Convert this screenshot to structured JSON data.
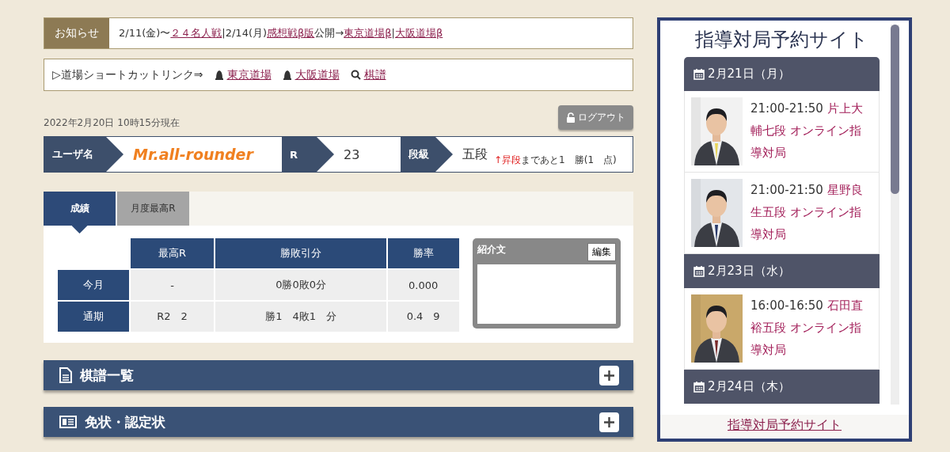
{
  "notice": {
    "label": "お知らせ",
    "segments": [
      {
        "kind": "text",
        "text": "2/11(金)〜"
      },
      {
        "kind": "link",
        "text": "２４名人戦"
      },
      {
        "kind": "text",
        "text": "|2/14(月)"
      },
      {
        "kind": "link",
        "text": "感想戦β版"
      },
      {
        "kind": "text",
        "text": "公開→"
      },
      {
        "kind": "link",
        "text": "東京道場β"
      },
      {
        "kind": "text",
        "text": "|"
      },
      {
        "kind": "link",
        "text": "大阪道場β"
      }
    ]
  },
  "shortcuts": {
    "label": "▷道場ショートカットリンク⇒",
    "links": [
      {
        "kind": "dojo",
        "text": "東京道場"
      },
      {
        "kind": "dojo",
        "text": "大阪道場"
      },
      {
        "kind": "search",
        "text": "棋譜"
      }
    ]
  },
  "timestamp": "2022年2月20日 10時15分現在",
  "logout_button": "ログアウト",
  "profile": {
    "fields": [
      {
        "kind": "name",
        "label": "ユーザ名",
        "value": "Mr.all-rounder"
      },
      {
        "kind": "plain",
        "label": "R",
        "value": "23"
      },
      {
        "kind": "rank",
        "label": "段級",
        "value": "五段"
      }
    ],
    "promotion": {
      "highlight": "↑昇段",
      "rest": "まであと1　勝(1　点)"
    }
  },
  "tabs": [
    {
      "label": "成績",
      "selected": true
    },
    {
      "label": "月度最高R",
      "selected": false
    }
  ],
  "stats": {
    "columns": [
      "最高R",
      "勝敗引分",
      "勝率"
    ],
    "rows": [
      {
        "label": "今月",
        "cells": [
          "-",
          "0勝0敗0分",
          "0.000"
        ]
      },
      {
        "label": "通期",
        "cells": [
          "R2　2",
          "勝1　4敗1　分",
          "0.4　9"
        ]
      }
    ]
  },
  "intro": {
    "title": "紹介文",
    "edit_button": "編集"
  },
  "sections": [
    {
      "kind": "document",
      "title": "棋譜一覧",
      "expanded": false
    },
    {
      "kind": "certificate",
      "title": "免状・認定状",
      "expanded": false
    }
  ],
  "booking": {
    "title": "指導対局予約サイト",
    "days": [
      {
        "date": "2月21日（月）",
        "lessons": [
          {
            "time": "21:00-21:50",
            "title": "片上大輔七段 オンライン指導対局"
          },
          {
            "time": "21:00-21:50",
            "title": "星野良生五段 オンライン指導対局"
          }
        ]
      },
      {
        "date": "2月23日（水）",
        "lessons": [
          {
            "time": "16:00-16:50",
            "title": "石田直裕五段 オンライン指導対局"
          }
        ]
      },
      {
        "date": "2月24日（木）"
      }
    ],
    "footer_link": "指導対局予約サイト"
  }
}
